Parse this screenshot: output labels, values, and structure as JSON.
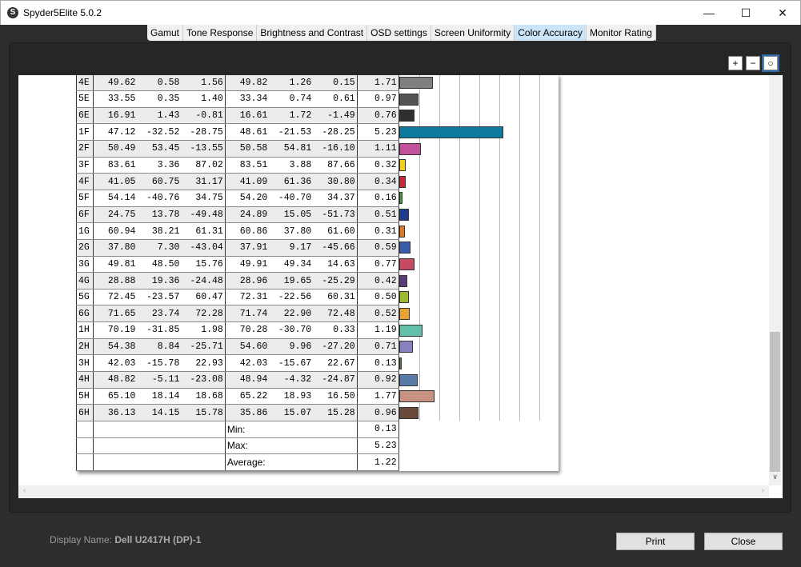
{
  "window": {
    "title": "Spyder5Elite 5.0.2",
    "app_icon": "S",
    "minimize": "—",
    "maximize": "☐",
    "close": "✕"
  },
  "tabs": [
    "Gamut",
    "Tone Response",
    "Brightness and Contrast",
    "OSD settings",
    "Screen Uniformity",
    "Color Accuracy",
    "Monitor Rating"
  ],
  "active_tab": "Color Accuracy",
  "zoom_buttons": {
    "zoom_in": "+",
    "zoom_out": "−",
    "zoom_fit": "○"
  },
  "rows": [
    {
      "id": "4E",
      "ref": [
        "49.62",
        "0.58",
        "1.56"
      ],
      "meas": [
        "49.82",
        "1.26",
        "0.15"
      ],
      "de": 1.71,
      "color": "#7f7f7f"
    },
    {
      "id": "5E",
      "ref": [
        "33.55",
        "0.35",
        "1.40"
      ],
      "meas": [
        "33.34",
        "0.74",
        "0.61"
      ],
      "de": 0.97,
      "color": "#545454"
    },
    {
      "id": "6E",
      "ref": [
        "16.91",
        "1.43",
        "-0.81"
      ],
      "meas": [
        "16.61",
        "1.72",
        "-1.49"
      ],
      "de": 0.76,
      "color": "#2f2f2f"
    },
    {
      "id": "1F",
      "ref": [
        "47.12",
        "-32.52",
        "-28.75"
      ],
      "meas": [
        "48.61",
        "-21.53",
        "-28.25"
      ],
      "de": 5.23,
      "color": "#0e7b9c"
    },
    {
      "id": "2F",
      "ref": [
        "50.49",
        "53.45",
        "-13.55"
      ],
      "meas": [
        "50.58",
        "54.81",
        "-16.10"
      ],
      "de": 1.11,
      "color": "#c2509a"
    },
    {
      "id": "3F",
      "ref": [
        "83.61",
        "3.36",
        "87.02"
      ],
      "meas": [
        "83.51",
        "3.88",
        "87.66"
      ],
      "de": 0.32,
      "color": "#f3d01e"
    },
    {
      "id": "4F",
      "ref": [
        "41.05",
        "60.75",
        "31.17"
      ],
      "meas": [
        "41.09",
        "61.36",
        "30.80"
      ],
      "de": 0.34,
      "color": "#c82838"
    },
    {
      "id": "5F",
      "ref": [
        "54.14",
        "-40.76",
        "34.75"
      ],
      "meas": [
        "54.20",
        "-40.70",
        "34.37"
      ],
      "de": 0.16,
      "color": "#40a040"
    },
    {
      "id": "6F",
      "ref": [
        "24.75",
        "13.78",
        "-49.48"
      ],
      "meas": [
        "24.89",
        "15.05",
        "-51.73"
      ],
      "de": 0.51,
      "color": "#1e3c8c"
    },
    {
      "id": "1G",
      "ref": [
        "60.94",
        "38.21",
        "61.31"
      ],
      "meas": [
        "60.86",
        "37.80",
        "61.60"
      ],
      "de": 0.31,
      "color": "#e07a22"
    },
    {
      "id": "2G",
      "ref": [
        "37.80",
        "7.30",
        "-43.04"
      ],
      "meas": [
        "37.91",
        "9.17",
        "-45.66"
      ],
      "de": 0.59,
      "color": "#3a5aaa"
    },
    {
      "id": "3G",
      "ref": [
        "49.81",
        "48.50",
        "15.76"
      ],
      "meas": [
        "49.91",
        "49.34",
        "14.63"
      ],
      "de": 0.77,
      "color": "#c84a62"
    },
    {
      "id": "4G",
      "ref": [
        "28.88",
        "19.36",
        "-24.48"
      ],
      "meas": [
        "28.96",
        "19.65",
        "-25.29"
      ],
      "de": 0.42,
      "color": "#5a3c7a"
    },
    {
      "id": "5G",
      "ref": [
        "72.45",
        "-23.57",
        "60.47"
      ],
      "meas": [
        "72.31",
        "-22.56",
        "60.31"
      ],
      "de": 0.5,
      "color": "#9cba30"
    },
    {
      "id": "6G",
      "ref": [
        "71.65",
        "23.74",
        "72.28"
      ],
      "meas": [
        "71.74",
        "22.90",
        "72.48"
      ],
      "de": 0.52,
      "color": "#e8a232"
    },
    {
      "id": "1H",
      "ref": [
        "70.19",
        "-31.85",
        "1.98"
      ],
      "meas": [
        "70.28",
        "-30.70",
        "0.33"
      ],
      "de": 1.19,
      "color": "#62c0a8"
    },
    {
      "id": "2H",
      "ref": [
        "54.38",
        "8.84",
        "-25.71"
      ],
      "meas": [
        "54.60",
        "9.96",
        "-27.20"
      ],
      "de": 0.71,
      "color": "#8882c0"
    },
    {
      "id": "3H",
      "ref": [
        "42.03",
        "-15.78",
        "22.93"
      ],
      "meas": [
        "42.03",
        "-15.67",
        "22.67"
      ],
      "de": 0.13,
      "color": "#508032"
    },
    {
      "id": "4H",
      "ref": [
        "48.82",
        "-5.11",
        "-23.08"
      ],
      "meas": [
        "48.94",
        "-4.32",
        "-24.87"
      ],
      "de": 0.92,
      "color": "#5a7aa8"
    },
    {
      "id": "5H",
      "ref": [
        "65.10",
        "18.14",
        "18.68"
      ],
      "meas": [
        "65.22",
        "18.93",
        "16.50"
      ],
      "de": 1.77,
      "color": "#c89282"
    },
    {
      "id": "6H",
      "ref": [
        "36.13",
        "14.15",
        "15.78"
      ],
      "meas": [
        "35.86",
        "15.07",
        "15.28"
      ],
      "de": 0.96,
      "color": "#6a4a3a"
    }
  ],
  "summary": [
    {
      "label": "Min:",
      "value": "0.13"
    },
    {
      "label": "Max:",
      "value": "5.23"
    },
    {
      "label": "Average:",
      "value": "1.22"
    }
  ],
  "footer": {
    "display_label": "Display Name:",
    "display_value": "Dell U2417H (DP)-1",
    "print": "Print",
    "close": "Close"
  }
}
